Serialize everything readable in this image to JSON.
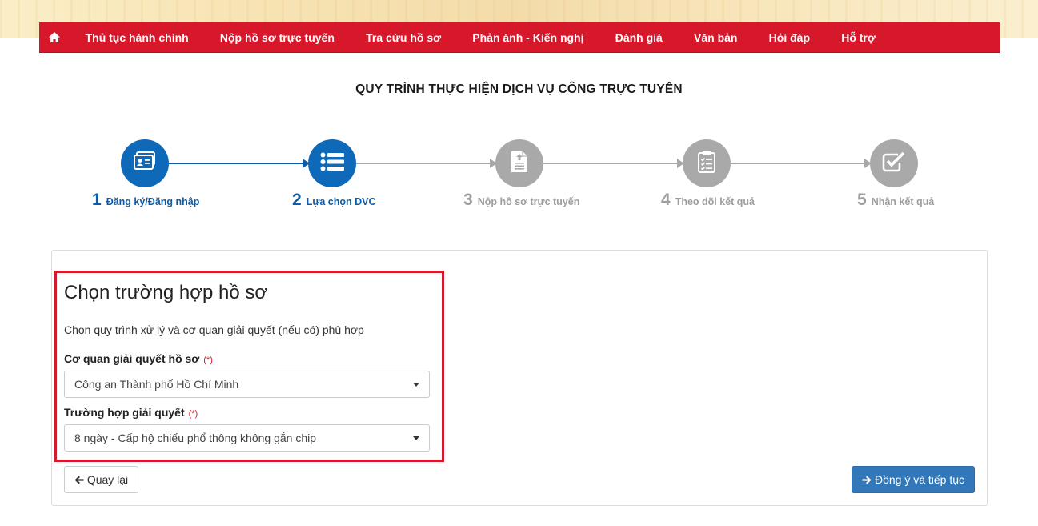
{
  "nav": {
    "home_icon": "home-icon",
    "items": [
      {
        "label": "Thủ tục hành chính"
      },
      {
        "label": "Nộp hồ sơ trực tuyến"
      },
      {
        "label": "Tra cứu hồ sơ"
      },
      {
        "label": "Phản ánh - Kiến nghị"
      },
      {
        "label": "Đánh giá"
      },
      {
        "label": "Văn bản"
      },
      {
        "label": "Hỏi đáp"
      },
      {
        "label": "Hỗ trợ"
      }
    ]
  },
  "page_title": "QUY TRÌNH THỰC HIỆN DỊCH VỤ CÔNG TRỰC TUYẾN",
  "steps": [
    {
      "num": "1",
      "label": "Đăng ký/Đăng nhập",
      "icon": "id-card-icon",
      "state": "active"
    },
    {
      "num": "2",
      "label": "Lựa chọn DVC",
      "icon": "list-icon",
      "state": "active"
    },
    {
      "num": "3",
      "label": "Nộp hồ sơ trực tuyến",
      "icon": "document-upload-icon",
      "state": "inactive"
    },
    {
      "num": "4",
      "label": "Theo dõi kết quả",
      "icon": "clipboard-checklist-icon",
      "state": "inactive"
    },
    {
      "num": "5",
      "label": "Nhận kết quả",
      "icon": "checkbox-icon",
      "state": "inactive"
    }
  ],
  "form": {
    "heading": "Chọn trường hợp hồ sơ",
    "description": "Chọn quy trình xử lý và cơ quan giải quyết (nếu có) phù hợp",
    "agency_label": "Cơ quan giải quyết hồ sơ",
    "agency_required": "(*)",
    "agency_value": "Công an Thành phố Hồ Chí Minh",
    "case_label": "Trường hợp giải quyết",
    "case_required": "(*)",
    "case_value": "8 ngày - Cấp hộ chiếu phổ thông không gắn chip"
  },
  "buttons": {
    "back_label": "Quay lại",
    "next_label": "Đồng ý và tiếp tục"
  },
  "colors": {
    "nav_red": "#d7182a",
    "step_active": "#0e69b8",
    "step_inactive": "#a9a9a9",
    "highlight_border": "#d3192b",
    "primary_button": "#3278b8"
  }
}
